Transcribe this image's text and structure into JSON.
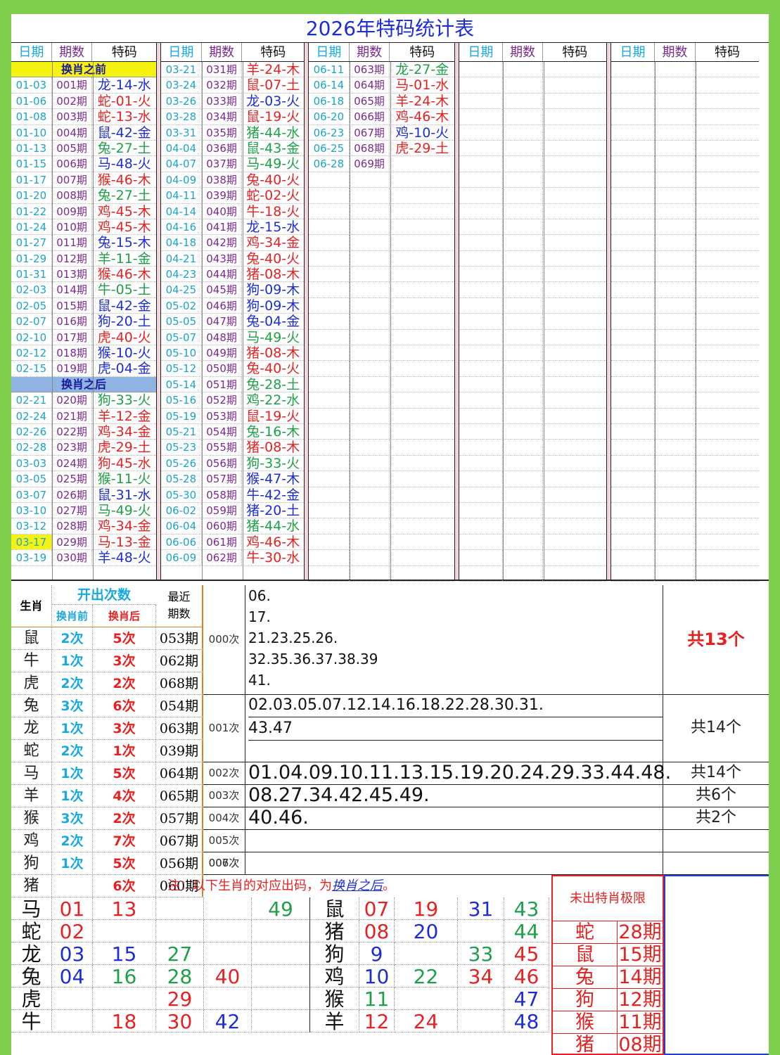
{
  "title": "2026年特码统计表",
  "headers": {
    "date": "日期",
    "issue": "期数",
    "code": "特码"
  },
  "section_before": "换肖之前",
  "section_after": "换肖之后",
  "colors": {
    "red": "#e52222",
    "blue": "#1d2dd6",
    "green": "#1ea048",
    "sect_before_bg": "#f6f313",
    "sect_after_bg": "#8fb4e3",
    "highlight": "#f6f313"
  },
  "col1_before": [
    [
      "01-03",
      "001期",
      "龙-14-水",
      "b"
    ],
    [
      "01-06",
      "002期",
      "蛇-01-火",
      "r"
    ],
    [
      "01-08",
      "003期",
      "蛇-13-水",
      "r"
    ],
    [
      "01-10",
      "004期",
      "鼠-42-金",
      "b"
    ],
    [
      "01-13",
      "005期",
      "兔-27-土",
      "g"
    ],
    [
      "01-15",
      "006期",
      "马-48-火",
      "b"
    ],
    [
      "01-17",
      "007期",
      "猴-46-木",
      "r"
    ],
    [
      "01-20",
      "008期",
      "兔-27-土",
      "g"
    ],
    [
      "01-22",
      "009期",
      "鸡-45-木",
      "r"
    ],
    [
      "01-24",
      "010期",
      "鸡-45-木",
      "r"
    ],
    [
      "01-27",
      "011期",
      "兔-15-木",
      "b"
    ],
    [
      "01-29",
      "012期",
      "羊-11-金",
      "g"
    ],
    [
      "01-31",
      "013期",
      "猴-46-木",
      "r"
    ],
    [
      "02-03",
      "014期",
      "牛-05-土",
      "g"
    ],
    [
      "02-05",
      "015期",
      "鼠-42-金",
      "b"
    ],
    [
      "02-07",
      "016期",
      "狗-20-土",
      "b"
    ],
    [
      "02-10",
      "017期",
      "虎-40-火",
      "r"
    ],
    [
      "02-12",
      "018期",
      "猴-10-火",
      "b"
    ],
    [
      "02-15",
      "019期",
      "虎-04-金",
      "b"
    ]
  ],
  "col1_after": [
    [
      "02-21",
      "020期",
      "狗-33-火",
      "g"
    ],
    [
      "02-24",
      "021期",
      "羊-12-金",
      "r"
    ],
    [
      "02-26",
      "022期",
      "鸡-34-金",
      "r"
    ],
    [
      "02-28",
      "023期",
      "虎-29-土",
      "r"
    ],
    [
      "03-03",
      "024期",
      "狗-45-水",
      "r"
    ],
    [
      "03-05",
      "025期",
      "猴-11-火",
      "g"
    ],
    [
      "03-07",
      "026期",
      "鼠-31-水",
      "b"
    ],
    [
      "03-10",
      "027期",
      "马-49-火",
      "g"
    ],
    [
      "03-12",
      "028期",
      "鸡-34-金",
      "r"
    ],
    [
      "03-17",
      "029期",
      "马-13-金",
      "r"
    ],
    [
      "03-19",
      "030期",
      "羊-48-火",
      "b"
    ]
  ],
  "col2": [
    [
      "03-21",
      "031期",
      "羊-24-木",
      "r"
    ],
    [
      "03-24",
      "032期",
      "鼠-07-土",
      "r"
    ],
    [
      "03-26",
      "033期",
      "龙-03-火",
      "b"
    ],
    [
      "03-28",
      "034期",
      "鼠-19-火",
      "r"
    ],
    [
      "03-31",
      "035期",
      "猪-44-水",
      "g"
    ],
    [
      "04-04",
      "036期",
      "鼠-43-金",
      "g"
    ],
    [
      "04-07",
      "037期",
      "马-49-火",
      "g"
    ],
    [
      "04-09",
      "038期",
      "兔-40-火",
      "r"
    ],
    [
      "04-11",
      "039期",
      "蛇-02-火",
      "r"
    ],
    [
      "04-14",
      "040期",
      "牛-18-火",
      "r"
    ],
    [
      "04-16",
      "041期",
      "龙-15-水",
      "b"
    ],
    [
      "04-18",
      "042期",
      "鸡-34-金",
      "r"
    ],
    [
      "04-21",
      "043期",
      "兔-40-火",
      "r"
    ],
    [
      "04-23",
      "044期",
      "猪-08-木",
      "r"
    ],
    [
      "04-25",
      "045期",
      "狗-09-木",
      "b"
    ],
    [
      "05-02",
      "046期",
      "狗-09-木",
      "b"
    ],
    [
      "05-05",
      "047期",
      "兔-04-金",
      "b"
    ],
    [
      "05-07",
      "048期",
      "马-49-火",
      "g"
    ],
    [
      "05-10",
      "049期",
      "猪-08-木",
      "r"
    ],
    [
      "05-12",
      "050期",
      "兔-40-火",
      "r"
    ],
    [
      "05-14",
      "051期",
      "兔-28-土",
      "g"
    ],
    [
      "05-16",
      "052期",
      "鸡-22-水",
      "g"
    ],
    [
      "05-19",
      "053期",
      "鼠-19-火",
      "r"
    ],
    [
      "05-21",
      "054期",
      "兔-16-木",
      "g"
    ],
    [
      "05-23",
      "055期",
      "猪-08-木",
      "r"
    ],
    [
      "05-26",
      "056期",
      "狗-33-火",
      "g"
    ],
    [
      "05-28",
      "057期",
      "猴-47-木",
      "b"
    ],
    [
      "05-30",
      "058期",
      "牛-42-金",
      "b"
    ],
    [
      "06-02",
      "059期",
      "猪-20-土",
      "b"
    ],
    [
      "06-04",
      "060期",
      "猪-44-水",
      "g"
    ],
    [
      "06-06",
      "061期",
      "鸡-46-木",
      "r"
    ],
    [
      "06-09",
      "062期",
      "牛-30-水",
      "r"
    ]
  ],
  "col3": [
    [
      "06-11",
      "063期",
      "龙-27-金",
      "g"
    ],
    [
      "06-14",
      "064期",
      "马-01-水",
      "r"
    ],
    [
      "06-18",
      "065期",
      "羊-24-木",
      "r"
    ],
    [
      "06-20",
      "066期",
      "鸡-46-木",
      "r"
    ],
    [
      "06-23",
      "067期",
      "鸡-10-火",
      "b"
    ],
    [
      "06-25",
      "068期",
      "虎-29-土",
      "r"
    ],
    [
      "06-28",
      "069期",
      "",
      ""
    ]
  ],
  "stats": {
    "zodiac_header": "生肖",
    "count_header": "开出次数",
    "before_header": "换肖前",
    "after_header": "换肖后",
    "recent_header1": "最近",
    "recent_header2": "期数",
    "rows": [
      [
        "鼠",
        "2次",
        "5次",
        "053期"
      ],
      [
        "牛",
        "1次",
        "3次",
        "062期"
      ],
      [
        "虎",
        "2次",
        "2次",
        "068期"
      ],
      [
        "兔",
        "3次",
        "6次",
        "054期"
      ],
      [
        "龙",
        "1次",
        "3次",
        "063期"
      ],
      [
        "蛇",
        "2次",
        "1次",
        "039期"
      ],
      [
        "马",
        "1次",
        "5次",
        "064期"
      ],
      [
        "羊",
        "1次",
        "4次",
        "065期"
      ],
      [
        "猴",
        "3次",
        "2次",
        "057期"
      ],
      [
        "鸡",
        "2次",
        "7次",
        "067期"
      ],
      [
        "狗",
        "1次",
        "5次",
        "056期"
      ],
      [
        "猪",
        "",
        "6次",
        "060期"
      ]
    ],
    "freq": [
      {
        "label": "000次",
        "lines": [
          "06.",
          "17.",
          "21.23.25.26.",
          "32.35.36.37.38.39",
          "41."
        ],
        "total": "共13个"
      },
      {
        "label": "001次",
        "lines": [
          "02.03.05.07.12.14.16.18.22.28.30.31.",
          "43.47"
        ],
        "total": "共14个"
      },
      {
        "label": "002次",
        "lines": [
          "01.04.09.10.11.13.15.19.20.24.29.33.44.48."
        ],
        "total": "共14个"
      },
      {
        "label": "003次",
        "lines": [
          "08.27.34.42.45.49."
        ],
        "total": "共6个"
      },
      {
        "label": "004次",
        "lines": [
          "40.46."
        ],
        "total": "共2个"
      },
      {
        "label": "005次",
        "lines": [],
        "total": ""
      },
      {
        "label": "006次",
        "lines": [],
        "total": ""
      },
      {
        "label": "007次",
        "lines": [],
        "total": ""
      }
    ]
  },
  "note_prefix": "注：以下生肖的对应出码，为",
  "note_link": "换肖之后",
  "note_suffix": "。",
  "mapping_left": [
    [
      "马",
      [
        "01",
        "r"
      ],
      [
        "13",
        "r"
      ],
      [
        "",
        ""
      ],
      [
        "",
        ""
      ],
      [
        "49",
        "g"
      ]
    ],
    [
      "蛇",
      [
        "02",
        "r"
      ],
      [
        "",
        ""
      ],
      [
        "",
        ""
      ],
      [
        "",
        ""
      ],
      [
        "",
        ""
      ]
    ],
    [
      "龙",
      [
        "03",
        "b"
      ],
      [
        "15",
        "b"
      ],
      [
        "27",
        "g"
      ],
      [
        "",
        ""
      ],
      [
        "",
        ""
      ]
    ],
    [
      "兔",
      [
        "04",
        "b"
      ],
      [
        "16",
        "g"
      ],
      [
        "28",
        "g"
      ],
      [
        "40",
        "r"
      ],
      [
        "",
        ""
      ]
    ],
    [
      "虎",
      [
        "",
        ""
      ],
      [
        "",
        ""
      ],
      [
        "29",
        "r"
      ],
      [
        "",
        ""
      ],
      [
        "",
        ""
      ]
    ],
    [
      "牛",
      [
        "",
        ""
      ],
      [
        "18",
        "r"
      ],
      [
        "30",
        "r"
      ],
      [
        "42",
        "b"
      ],
      [
        "",
        ""
      ]
    ]
  ],
  "mapping_right": [
    [
      "鼠",
      [
        "07",
        "r"
      ],
      [
        "19",
        "r"
      ],
      [
        "31",
        "b"
      ],
      [
        "43",
        "g"
      ]
    ],
    [
      "猪",
      [
        "08",
        "r"
      ],
      [
        "20",
        "b"
      ],
      [
        "",
        ""
      ],
      [
        "44",
        "g"
      ]
    ],
    [
      "狗",
      [
        "9",
        "b"
      ],
      [
        "",
        ""
      ],
      [
        "33",
        "g"
      ],
      [
        "45",
        "r"
      ]
    ],
    [
      "鸡",
      [
        "10",
        "b"
      ],
      [
        "22",
        "g"
      ],
      [
        "34",
        "r"
      ],
      [
        "46",
        "r"
      ]
    ],
    [
      "猴",
      [
        "11",
        "g"
      ],
      [
        "",
        ""
      ],
      [
        "",
        ""
      ],
      [
        "47",
        "b"
      ]
    ],
    [
      "羊",
      [
        "12",
        "r"
      ],
      [
        "24",
        "r"
      ],
      [
        "",
        ""
      ],
      [
        "48",
        "b"
      ]
    ]
  ],
  "limit": {
    "title": "未出特肖极限",
    "rows": [
      [
        "蛇",
        "28期"
      ],
      [
        "鼠",
        "15期"
      ],
      [
        "兔",
        "14期"
      ],
      [
        "狗",
        "12期"
      ],
      [
        "猴",
        "11期"
      ],
      [
        "猪",
        "08期"
      ]
    ]
  }
}
